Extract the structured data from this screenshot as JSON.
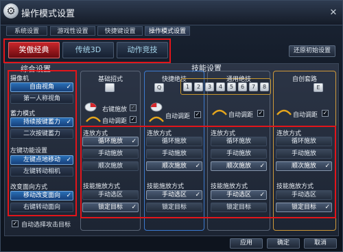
{
  "window": {
    "title": "操作模式设置",
    "close": "✕"
  },
  "top_tabs": [
    "系统设置",
    "游戏性设置",
    "快捷键设置",
    "操作模式设置"
  ],
  "schemes": [
    "笑傲经典",
    "传统3D",
    "动作竞技"
  ],
  "restore_label": "还原初始设置",
  "general": {
    "title": "综合设置",
    "groups": [
      {
        "label": "摄像机",
        "options": [
          "自由视角",
          "第一人称视角"
        ]
      },
      {
        "label": "蓄力模式",
        "options": [
          "持续按键蓄力",
          "二次按键蓄力"
        ]
      },
      {
        "label": "左键功能设置",
        "options": [
          "左键点地移动",
          "左键转动相机"
        ]
      },
      {
        "label": "改变面向方式",
        "options": [
          "移动改变面向",
          "右键转动面向"
        ]
      }
    ],
    "auto_select_label": "自动选择攻击目标"
  },
  "skill_settings_title": "技能设置",
  "columns": {
    "basic": {
      "title": "基础招式",
      "key": "",
      "right_click_label": "右键施放",
      "auto_range_label": "自动调距"
    },
    "shortcut": {
      "title": "快捷绝技",
      "key": "Q",
      "auto_range_label": "自动调距"
    },
    "common": {
      "title": "通用绝技",
      "keys": [
        "1",
        "2",
        "3",
        "4",
        "5",
        "6",
        "7",
        "8"
      ],
      "auto_range_label": "自动调距"
    },
    "custom": {
      "title": "自创套路",
      "key": "E",
      "auto_range_label": "自动调距"
    }
  },
  "release_mode_label": "连放方式",
  "release_modes": [
    "循环施放",
    "手动施放",
    "顺次施放"
  ],
  "cast_mode_label": "技能施放方式",
  "cast_modes": [
    "手动选区",
    "锁定目标"
  ],
  "footer": {
    "apply": "应用",
    "ok": "确定",
    "cancel": "取消"
  },
  "highlight_color": "#e3151a"
}
